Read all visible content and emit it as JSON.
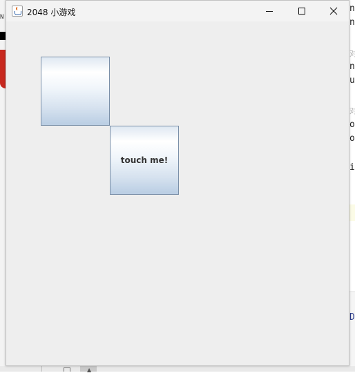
{
  "window": {
    "title": "2048 小游戏"
  },
  "tiles": [
    {
      "label": ""
    },
    {
      "label": "touch me!"
    }
  ],
  "background": {
    "left_char": "N",
    "right_code": [
      "n",
      "n",
      "n",
      "u",
      "o",
      "o",
      "i",
      "D"
    ],
    "right_muted": [
      "对",
      "对"
    ]
  },
  "icons": {
    "app": "java-coffee-cup-icon",
    "minimize": "minimize-icon",
    "maximize": "maximize-icon",
    "close": "close-icon"
  }
}
